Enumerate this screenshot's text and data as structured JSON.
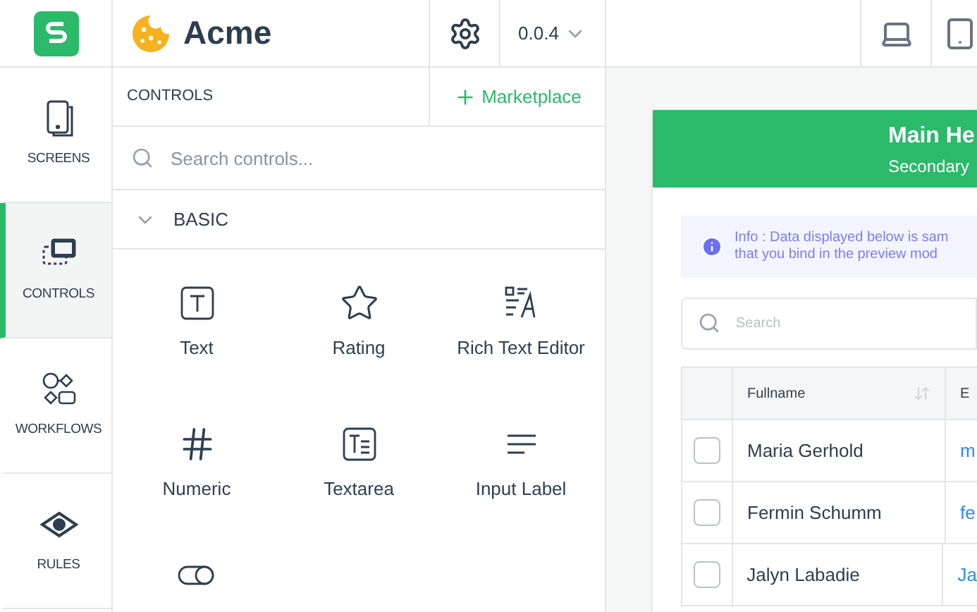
{
  "brand": {
    "name": "Acme"
  },
  "version": "0.0.4",
  "rail": [
    {
      "label": "SCREENS",
      "selected": false
    },
    {
      "label": "CONTROLS",
      "selected": true
    },
    {
      "label": "WORKFLOWS",
      "selected": false
    },
    {
      "label": "RULES",
      "selected": false
    }
  ],
  "panel": {
    "title": "CONTROLS",
    "marketplace": "Marketplace",
    "search_placeholder": "Search controls...",
    "section": {
      "label": "BASIC",
      "expanded": true
    },
    "controls": [
      {
        "kind": "text",
        "label": "Text"
      },
      {
        "kind": "rating",
        "label": "Rating"
      },
      {
        "kind": "richtext",
        "label": "Rich Text Editor"
      },
      {
        "kind": "numeric",
        "label": "Numeric"
      },
      {
        "kind": "textarea",
        "label": "Textarea"
      },
      {
        "kind": "label",
        "label": "Input Label"
      },
      {
        "kind": "toggle"
      }
    ]
  },
  "preview": {
    "title": "Main He",
    "subtitle": "Secondary",
    "info": [
      "Info : Data displayed below is sam",
      "that you bind in the preview mod"
    ],
    "search_placeholder": "Search",
    "columns": [
      "Fullname",
      "E"
    ],
    "rows": [
      {
        "name": "Maria Gerhold",
        "email": "m",
        "selected": false
      },
      {
        "name": "Fermin Schumm",
        "email": "fe",
        "selected": false
      },
      {
        "name": "Jalyn Labadie",
        "email": "Ja",
        "selected": false
      }
    ]
  }
}
